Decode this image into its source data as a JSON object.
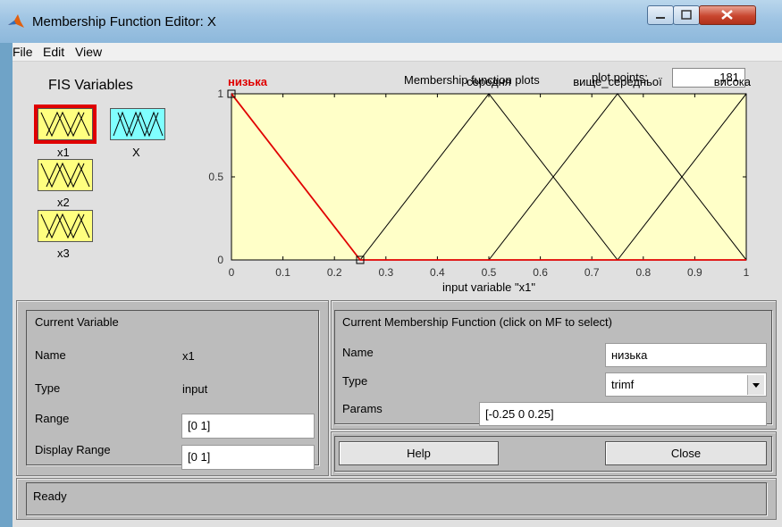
{
  "window": {
    "title": "Membership Function Editor: X"
  },
  "menu": [
    "File",
    "Edit",
    "View"
  ],
  "fis_variables": {
    "heading": "FIS Variables",
    "inputs": [
      {
        "label": "x1",
        "selected": true
      },
      {
        "label": "x2",
        "selected": false
      },
      {
        "label": "x3",
        "selected": false
      }
    ],
    "output": {
      "label": "X"
    }
  },
  "plot": {
    "title": "Membership function plots",
    "plot_points_label": "plot points:",
    "plot_points_value": "181",
    "xlabel": "input variable \"x1\""
  },
  "chart_data": {
    "type": "line",
    "xlabel": "input variable \"x1\"",
    "xlim": [
      0,
      1
    ],
    "ylim": [
      0,
      1
    ],
    "x_ticks": [
      "0",
      "0.1",
      "0.2",
      "0.3",
      "0.4",
      "0.5",
      "0.6",
      "0.7",
      "0.8",
      "0.9",
      "1"
    ],
    "y_ticks": [
      "0",
      "0.5",
      "1"
    ],
    "background": "#ffffc8",
    "series": [
      {
        "name": "низька",
        "type": "trimf",
        "params": [
          -0.25,
          0,
          0.25
        ],
        "color": "#e00000",
        "selected": true
      },
      {
        "name": "середня",
        "type": "trimf",
        "params": [
          0.25,
          0.5,
          0.75
        ],
        "color": "#000000"
      },
      {
        "name": "вище_середньої",
        "type": "trimf",
        "params": [
          0.5,
          0.75,
          1.0
        ],
        "color": "#000000"
      },
      {
        "name": "висока",
        "type": "trimf",
        "params": [
          0.75,
          1.0,
          1.25
        ],
        "color": "#000000"
      }
    ]
  },
  "current_variable": {
    "heading": "Current Variable",
    "name_label": "Name",
    "name_value": "x1",
    "type_label": "Type",
    "type_value": "input",
    "range_label": "Range",
    "range_value": "[0 1]",
    "display_range_label": "Display Range",
    "display_range_value": "[0 1]"
  },
  "current_mf": {
    "heading": "Current Membership Function (click on MF to select)",
    "name_label": "Name",
    "name_value": "низька",
    "type_label": "Type",
    "type_value": "trimf",
    "params_label": "Params",
    "params_value": "[-0.25 0 0.25]"
  },
  "buttons": {
    "help": "Help",
    "close": "Close"
  },
  "status": "Ready",
  "colors": {
    "selected_mf": "#e00000",
    "input_var_fill": "#ffff80",
    "output_var_fill": "#80ffff",
    "plot_bg": "#ffffc8"
  }
}
